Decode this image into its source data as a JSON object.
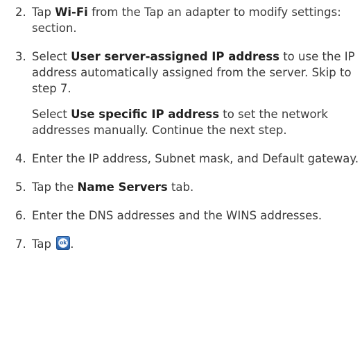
{
  "steps": [
    {
      "num": "2.",
      "pre": "Tap ",
      "bold": "Wi-Fi",
      "post": " from the Tap an adapter to modify settings: section."
    },
    {
      "num": "3.",
      "pre": "Select ",
      "bold": "User server-assigned IP address",
      "post": " to use the IP address automatically assigned from the server. Skip to step 7.",
      "extra": {
        "pre": "Select ",
        "bold": "Use specific IP address",
        "post": " to set the network addresses manually. Continue the next step."
      }
    },
    {
      "num": "4.",
      "text": "Enter the IP address, Subnet mask, and Default gateway."
    },
    {
      "num": "5.",
      "pre": "Tap the ",
      "bold": "Name Servers",
      "post": " tab."
    },
    {
      "num": "6.",
      "text": "Enter the DNS addresses and the WINS addresses."
    },
    {
      "num": "7.",
      "pre": "Tap ",
      "icon": "ok-icon",
      "icon_text": "ok",
      "post": "."
    }
  ]
}
